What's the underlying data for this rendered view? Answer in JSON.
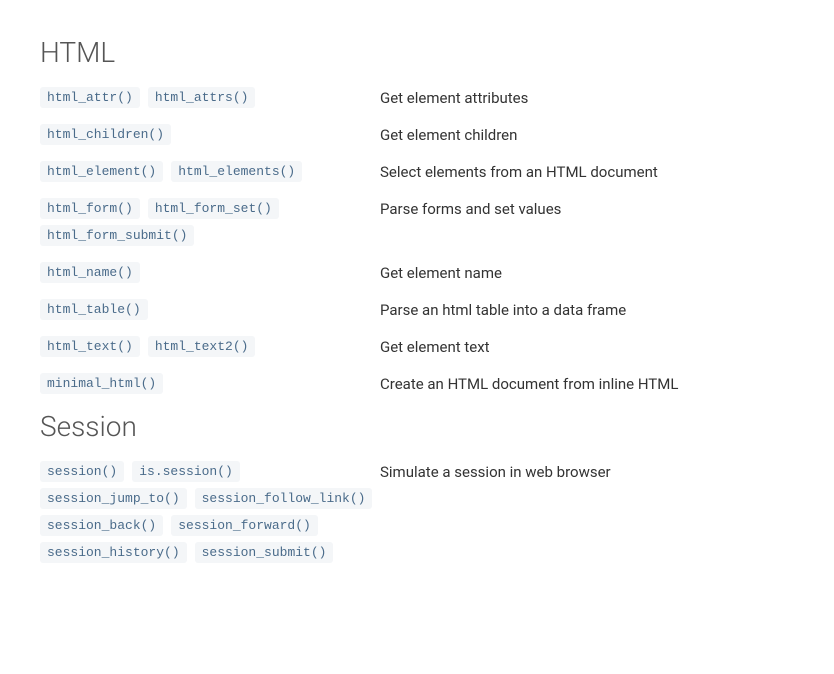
{
  "sections": [
    {
      "heading": "HTML",
      "entries": [
        {
          "funcs": [
            "html_attr()",
            "html_attrs()"
          ],
          "desc": "Get element attributes"
        },
        {
          "funcs": [
            "html_children()"
          ],
          "desc": "Get element children"
        },
        {
          "funcs": [
            "html_element()",
            "html_elements()"
          ],
          "desc": "Select elements from an HTML document"
        },
        {
          "funcs": [
            "html_form()",
            "html_form_set()",
            "html_form_submit()"
          ],
          "desc": "Parse forms and set values"
        },
        {
          "funcs": [
            "html_name()"
          ],
          "desc": "Get element name"
        },
        {
          "funcs": [
            "html_table()"
          ],
          "desc": "Parse an html table into a data frame"
        },
        {
          "funcs": [
            "html_text()",
            "html_text2()"
          ],
          "desc": "Get element text"
        },
        {
          "funcs": [
            "minimal_html()"
          ],
          "desc": "Create an HTML document from inline HTML"
        }
      ]
    },
    {
      "heading": "Session",
      "entries": [
        {
          "funcs": [
            "session()",
            "is.session()",
            "session_jump_to()",
            "session_follow_link()",
            "session_back()",
            "session_forward()",
            "session_history()",
            "session_submit()"
          ],
          "desc": "Simulate a session in web browser"
        }
      ]
    }
  ]
}
